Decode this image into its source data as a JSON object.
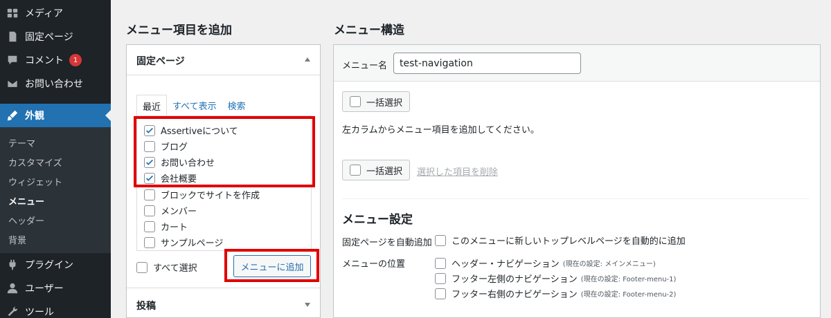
{
  "sidebar": {
    "top_items": [
      {
        "label": "メディア",
        "icon": "media-icon"
      },
      {
        "label": "固定ページ",
        "icon": "page-icon"
      },
      {
        "label": "コメント",
        "icon": "comment-icon",
        "badge": "1"
      },
      {
        "label": "お問い合わせ",
        "icon": "mail-icon"
      }
    ],
    "active_item": {
      "label": "外観",
      "icon": "appearance-brush-icon"
    },
    "submenu": [
      "テーマ",
      "カスタマイズ",
      "ウィジェット",
      "メニュー",
      "ヘッダー",
      "背景"
    ],
    "current_submenu": "メニュー",
    "bottom_items": [
      {
        "label": "プラグイン",
        "icon": "plugin-icon"
      },
      {
        "label": "ユーザー",
        "icon": "user-icon"
      },
      {
        "label": "ツール",
        "icon": "tool-icon"
      }
    ]
  },
  "left": {
    "heading": "メニュー項目を追加",
    "panel_title": "固定ページ",
    "tabs": [
      "最近",
      "すべて表示",
      "検索"
    ],
    "active_tab": "最近",
    "pages": [
      {
        "label": "Assertiveについて",
        "checked": true
      },
      {
        "label": "ブログ",
        "checked": false
      },
      {
        "label": "お問い合わせ",
        "checked": true
      },
      {
        "label": "会社概要",
        "checked": true
      },
      {
        "label": "ブロックでサイトを作成",
        "checked": false
      },
      {
        "label": "メンバー",
        "checked": false
      },
      {
        "label": "カート",
        "checked": false
      },
      {
        "label": "サンプルページ",
        "checked": false
      }
    ],
    "select_all_label": "すべて選択",
    "add_button": "メニューに追加",
    "posts_title": "投稿"
  },
  "right": {
    "heading": "メニュー構造",
    "menu_name_label": "メニュー名",
    "menu_name_value": "test-navigation",
    "bulk_select": "一括選択",
    "instruction": "左カラムからメニュー項目を追加してください。",
    "delete_selected": "選択した項目を削除",
    "settings_title": "メニュー設定",
    "auto_add_label": "固定ページを自動追加",
    "auto_add_option": "このメニューに新しいトップレベルページを自動的に追加",
    "location_label": "メニューの位置",
    "locations": [
      {
        "label": "ヘッダー・ナビゲーション",
        "note": "(現在の設定: メインメニュー)"
      },
      {
        "label": "フッター左側のナビゲーション",
        "note": "(現在の設定: Footer-menu-1)"
      },
      {
        "label": "フッター右側のナビゲーション",
        "note": "(現在の設定: Footer-menu-2)"
      }
    ]
  },
  "colors": {
    "accent": "#2271b1",
    "highlight_box": "#e00000",
    "sidebar": "#1d2327"
  }
}
